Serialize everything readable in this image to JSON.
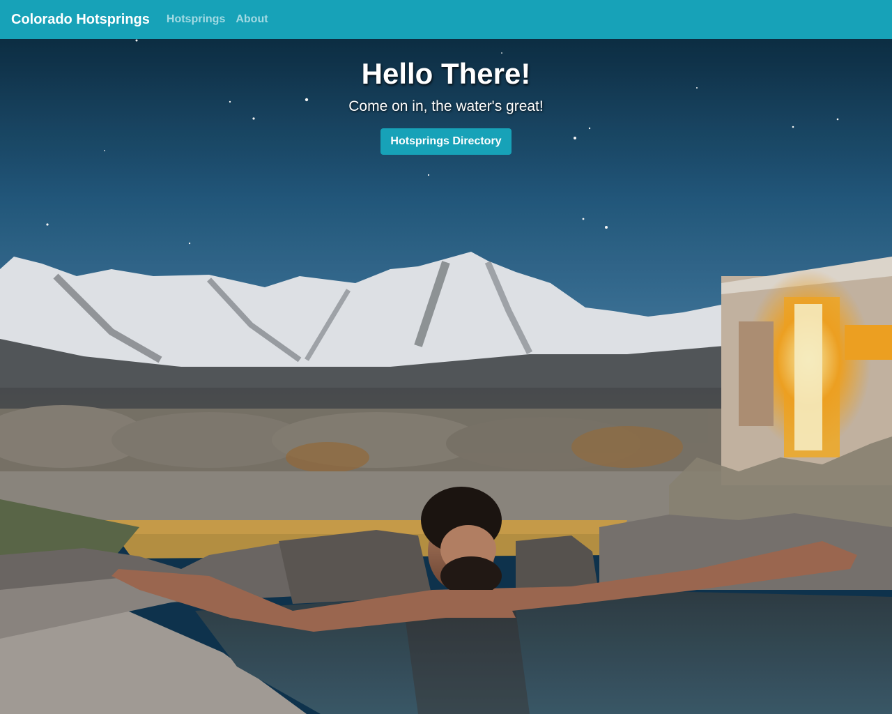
{
  "navbar": {
    "brand": "Colorado Hotsprings",
    "links": [
      {
        "label": "Hotsprings"
      },
      {
        "label": "About"
      }
    ]
  },
  "hero": {
    "title": "Hello There!",
    "subtitle": "Come on in, the water's great!",
    "cta_label": "Hotsprings Directory"
  },
  "colors": {
    "navbar_bg": "#17a2b8",
    "button_bg": "#17a2b8",
    "text": "#ffffff"
  }
}
